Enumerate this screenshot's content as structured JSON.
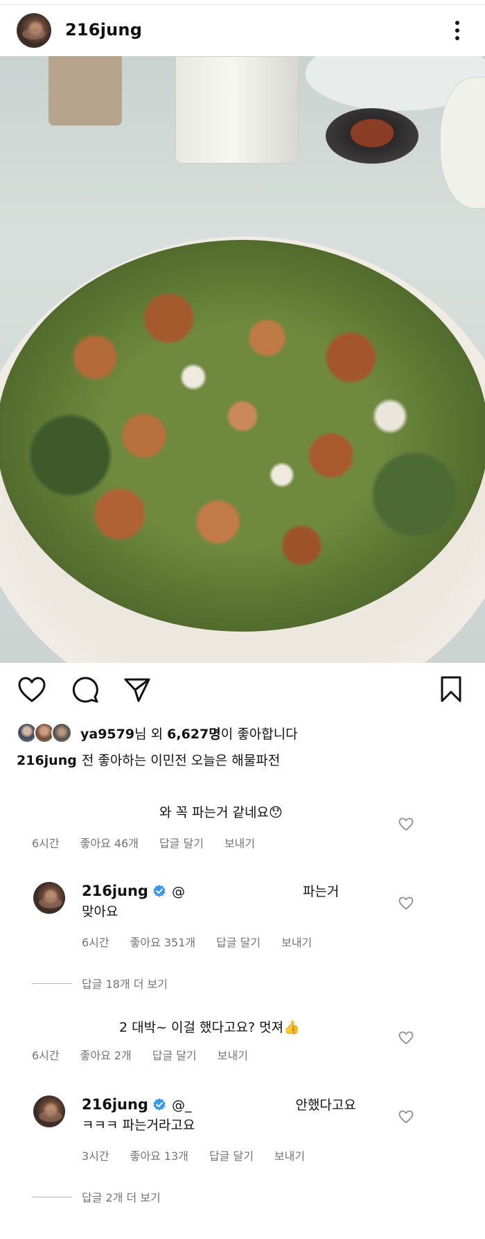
{
  "post": {
    "username": "216jung"
  },
  "likes": {
    "first_user": "ya9579",
    "suffix_1": "님 외 ",
    "count": "6,627명",
    "suffix_2": "이 좋아합니다"
  },
  "caption": {
    "username": "216jung",
    "text": "전 좋아하는 이민전 오늘은 해물파전"
  },
  "comments": [
    {
      "text": "와 꼭 파는거 같네요😯",
      "time": "6시간",
      "likes": "좋아요 46개",
      "reply": "답글 달기",
      "send": "보내기"
    },
    {
      "username": "216jung",
      "mention": "@",
      "text_line1_end": "파는거",
      "text_line2": "맞아요",
      "time": "6시간",
      "likes": "좋아요 351개",
      "reply": "답글 달기",
      "send": "보내기",
      "view_replies": "답글 18개 더 보기"
    },
    {
      "text": "2 대박~  이걸 했다고요? 멋져👍",
      "time": "6시간",
      "likes": "좋아요 2개",
      "reply": "답글 달기",
      "send": "보내기"
    },
    {
      "username": "216jung",
      "mention": "@_",
      "text_line1_end": "안했다고요",
      "text_line2": "ㅋㅋㅋ 파는거라고요",
      "time": "3시간",
      "likes": "좋아요 13개",
      "reply": "답글 달기",
      "send": "보내기",
      "view_replies": "답글 2개 더 보기"
    }
  ],
  "colors": {
    "text": "#111111",
    "muted": "#737373",
    "verified": "#3897f0"
  },
  "icons": [
    "more-options-icon",
    "heart-icon",
    "comment-icon",
    "share-icon",
    "bookmark-icon",
    "verified-badge-icon"
  ]
}
